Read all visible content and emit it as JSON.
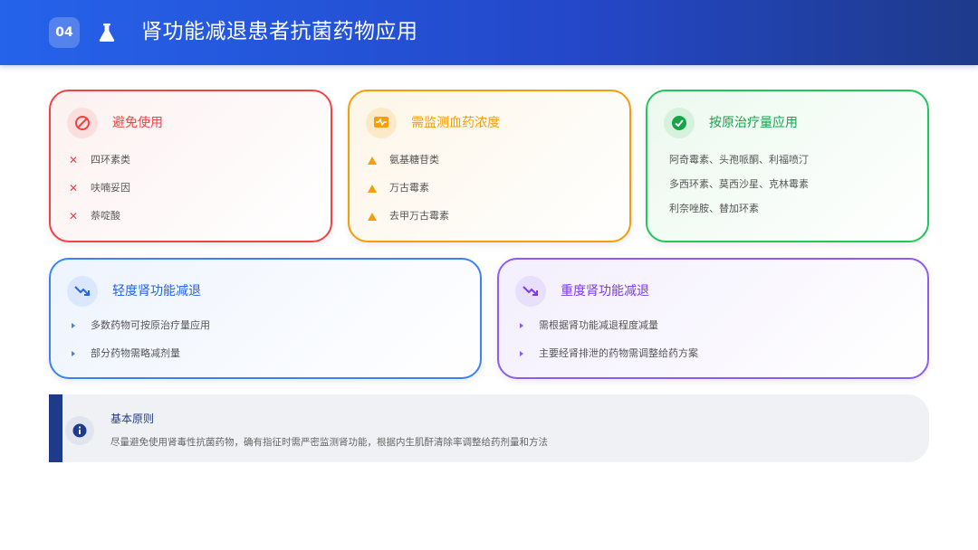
{
  "header": {
    "section_number": "04",
    "icon": "flask-icon",
    "title": "肾功能减退患者抗菌药物应用"
  },
  "cards": {
    "avoid": {
      "icon": "ban-icon",
      "title": "避免使用",
      "items": [
        "四环素类",
        "呋喃妥因",
        "萘啶酸"
      ],
      "color": "#ef4444"
    },
    "monitor": {
      "icon": "monitor-pulse-icon",
      "title": "需监测血药浓度",
      "items": [
        "氨基糖苷类",
        "万古霉素",
        "去甲万古霉素"
      ],
      "color": "#f59e0b"
    },
    "original": {
      "icon": "check-circle-icon",
      "title": "按原治疗量应用",
      "lines": [
        "阿奇霉素、头孢哌酮、利福喷汀",
        "多西环素、莫西沙星、克林霉素",
        "利奈唑胺、替加环素"
      ],
      "color": "#16a34a"
    },
    "mild": {
      "icon": "trend-down-icon",
      "title": "轻度肾功能减退",
      "items": [
        "多数药物可按原治疗量应用",
        "部分药物需略减剂量"
      ],
      "color": "#2563eb"
    },
    "severe": {
      "icon": "trend-down-icon",
      "title": "重度肾功能减退",
      "items": [
        "需根据肾功能减退程度减量",
        "主要经肾排泄的药物需调整给药方案"
      ],
      "color": "#7c3aed"
    }
  },
  "principle": {
    "icon": "info-icon",
    "title": "基本原则",
    "text": "尽量避免使用肾毒性抗菌药物，确有指征时需严密监测肾功能，根据内生肌酐清除率调整给药剂量和方法"
  }
}
